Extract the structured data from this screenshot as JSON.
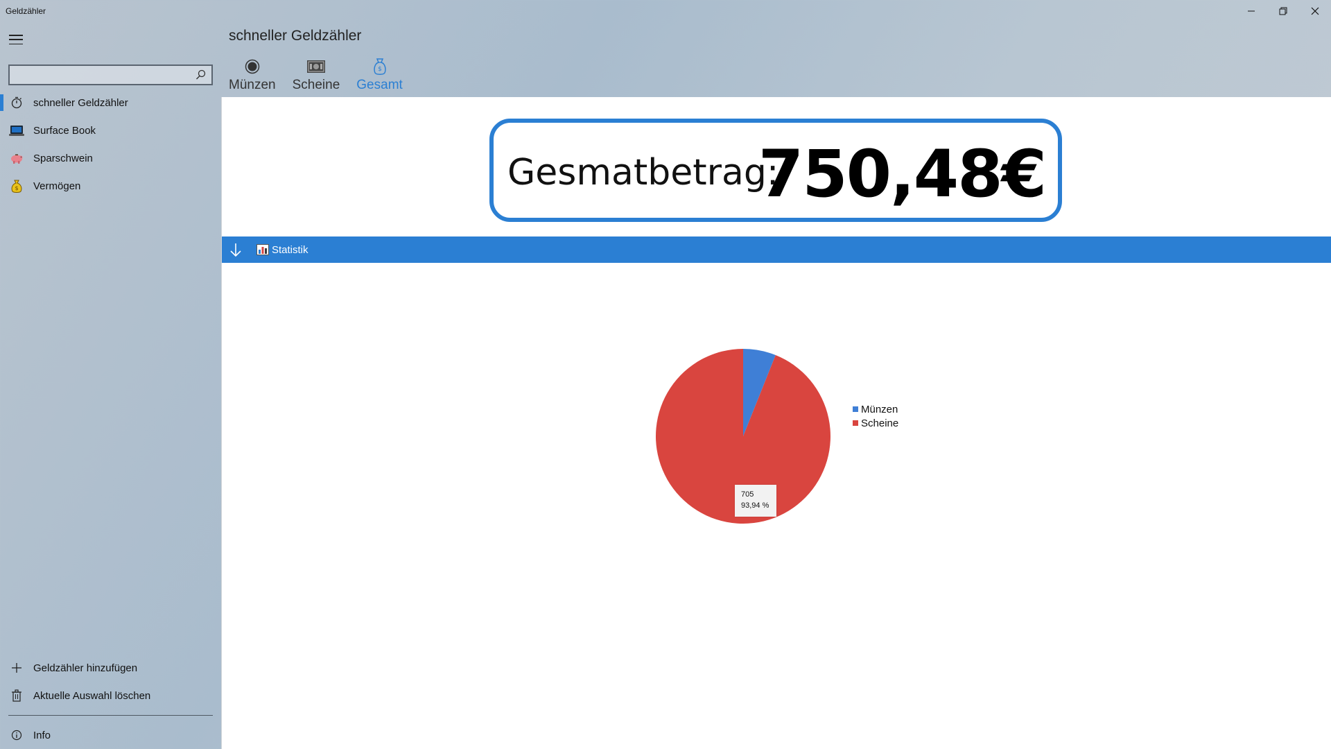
{
  "window": {
    "title": "Geldzähler",
    "controls": {
      "minimize": "—",
      "maximize": "❐",
      "close": "✕"
    }
  },
  "search": {
    "value": "",
    "placeholder": ""
  },
  "sidebar": {
    "items": [
      {
        "label": "schneller Geldzähler",
        "icon": "stopwatch-icon",
        "selected": true
      },
      {
        "label": "Surface Book",
        "icon": "laptop-icon",
        "selected": false
      },
      {
        "label": "Sparschwein",
        "icon": "piggy-bank-icon",
        "selected": false
      },
      {
        "label": "Vermögen",
        "icon": "money-bag-icon",
        "selected": false
      }
    ],
    "bottom": [
      {
        "label": "Geldzähler hinzufügen",
        "icon": "plus-icon"
      },
      {
        "label": "Aktuelle Auswahl löschen",
        "icon": "trash-icon"
      },
      {
        "label": "Info",
        "icon": "info-icon"
      }
    ]
  },
  "header": {
    "title": "schneller Geldzähler",
    "tabs": [
      {
        "label": "Münzen",
        "icon": "coin-icon",
        "active": false
      },
      {
        "label": "Scheine",
        "icon": "banknote-icon",
        "active": false
      },
      {
        "label": "Gesamt",
        "icon": "money-bag-icon",
        "active": true
      }
    ]
  },
  "total": {
    "label": "Gesmatbetrag:",
    "value": "750,48€"
  },
  "statistics": {
    "label": "Statistik"
  },
  "colors": {
    "accent": "#2b7fd3",
    "muenzen": "#3f7fd6",
    "scheine": "#d9453f"
  },
  "chart_data": {
    "type": "pie",
    "categories": [
      "Münzen",
      "Scheine"
    ],
    "values": [
      45.48,
      705
    ],
    "colors": [
      "#3f7fd6",
      "#d9453f"
    ],
    "legend": "right",
    "tooltip": {
      "value": "705",
      "percent": "93,94 %"
    }
  }
}
